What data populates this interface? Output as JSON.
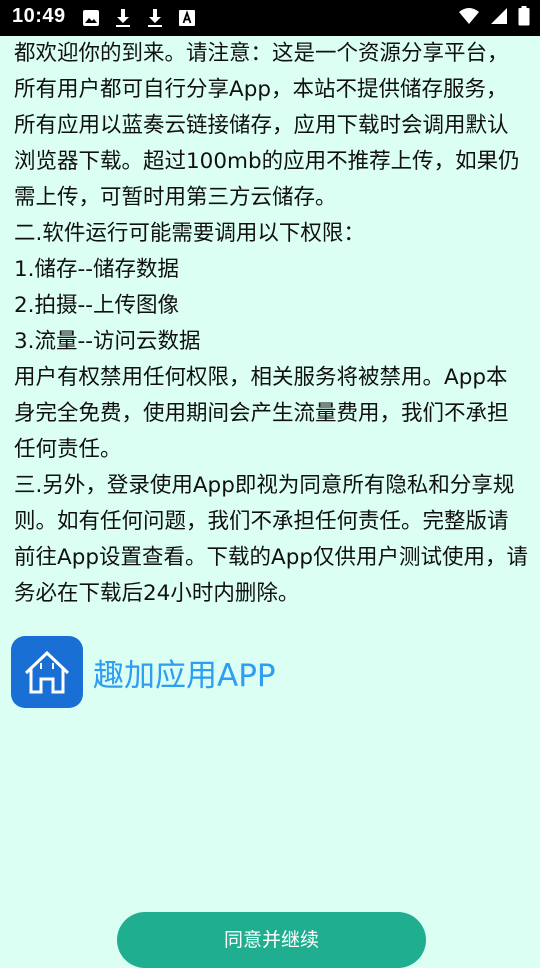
{
  "status_bar": {
    "time": "10:49",
    "left_icons": [
      "image-icon",
      "download-icon",
      "download-icon",
      "font-a-icon"
    ],
    "right_icons": [
      "wifi-icon",
      "signal-icon",
      "battery-icon"
    ]
  },
  "agreement": {
    "paragraphs": [
      "都欢迎你的到来。请注意：这是一个资源分享平台，所有用户都可自行分享App，本站不提供储存服务，所有应用以蓝奏云链接储存，应用下载时会调用默认浏览器下载。超过100mb的应用不推荐上传，如果仍需上传，可暂时用第三方云储存。",
      "二.软件运行可能需要调用以下权限：",
      "1.储存--储存数据",
      "2.拍摄--上传图像",
      "3.流量--访问云数据",
      "用户有权禁用任何权限，相关服务将被禁用。App本身完全免费，使用期间会产生流量费用，我们不承担任何责任。",
      "三.另外，登录使用App即视为同意所有隐私和分享规则。如有任何问题，我们不承担任何责任。完整版请前往App设置查看。下载的App仅供用户测试使用，请务必在下载后24小时内删除。"
    ]
  },
  "app": {
    "name": "趣加应用APP",
    "icon": "home-icon",
    "icon_color": "#1a6fd4",
    "name_color": "#2e9df2"
  },
  "actions": {
    "agree_label": "同意并继续",
    "agree_color": "#1fae8f"
  },
  "colors": {
    "background": "#dcfff3"
  }
}
